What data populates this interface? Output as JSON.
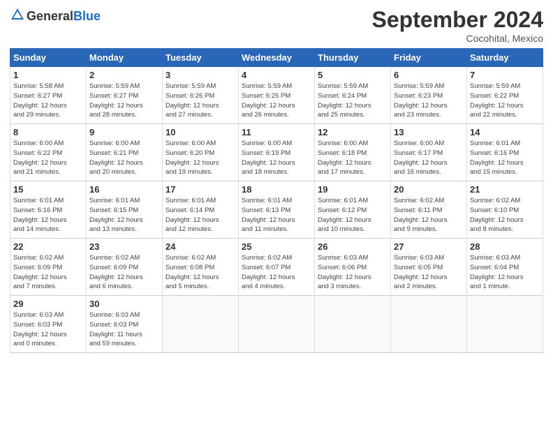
{
  "header": {
    "logo_general": "General",
    "logo_blue": "Blue",
    "title": "September 2024",
    "location": "Cocohital, Mexico"
  },
  "days_of_week": [
    "Sunday",
    "Monday",
    "Tuesday",
    "Wednesday",
    "Thursday",
    "Friday",
    "Saturday"
  ],
  "weeks": [
    [
      {
        "day": "1",
        "info": "Sunrise: 5:58 AM\nSunset: 6:27 PM\nDaylight: 12 hours\nand 29 minutes."
      },
      {
        "day": "2",
        "info": "Sunrise: 5:59 AM\nSunset: 6:27 PM\nDaylight: 12 hours\nand 28 minutes."
      },
      {
        "day": "3",
        "info": "Sunrise: 5:59 AM\nSunset: 6:26 PM\nDaylight: 12 hours\nand 27 minutes."
      },
      {
        "day": "4",
        "info": "Sunrise: 5:59 AM\nSunset: 6:25 PM\nDaylight: 12 hours\nand 26 minutes."
      },
      {
        "day": "5",
        "info": "Sunrise: 5:59 AM\nSunset: 6:24 PM\nDaylight: 12 hours\nand 25 minutes."
      },
      {
        "day": "6",
        "info": "Sunrise: 5:59 AM\nSunset: 6:23 PM\nDaylight: 12 hours\nand 23 minutes."
      },
      {
        "day": "7",
        "info": "Sunrise: 5:59 AM\nSunset: 6:22 PM\nDaylight: 12 hours\nand 22 minutes."
      }
    ],
    [
      {
        "day": "8",
        "info": "Sunrise: 6:00 AM\nSunset: 6:22 PM\nDaylight: 12 hours\nand 21 minutes."
      },
      {
        "day": "9",
        "info": "Sunrise: 6:00 AM\nSunset: 6:21 PM\nDaylight: 12 hours\nand 20 minutes."
      },
      {
        "day": "10",
        "info": "Sunrise: 6:00 AM\nSunset: 6:20 PM\nDaylight: 12 hours\nand 19 minutes."
      },
      {
        "day": "11",
        "info": "Sunrise: 6:00 AM\nSunset: 6:19 PM\nDaylight: 12 hours\nand 18 minutes."
      },
      {
        "day": "12",
        "info": "Sunrise: 6:00 AM\nSunset: 6:18 PM\nDaylight: 12 hours\nand 17 minutes."
      },
      {
        "day": "13",
        "info": "Sunrise: 6:00 AM\nSunset: 6:17 PM\nDaylight: 12 hours\nand 16 minutes."
      },
      {
        "day": "14",
        "info": "Sunrise: 6:01 AM\nSunset: 6:16 PM\nDaylight: 12 hours\nand 15 minutes."
      }
    ],
    [
      {
        "day": "15",
        "info": "Sunrise: 6:01 AM\nSunset: 6:16 PM\nDaylight: 12 hours\nand 14 minutes."
      },
      {
        "day": "16",
        "info": "Sunrise: 6:01 AM\nSunset: 6:15 PM\nDaylight: 12 hours\nand 13 minutes."
      },
      {
        "day": "17",
        "info": "Sunrise: 6:01 AM\nSunset: 6:14 PM\nDaylight: 12 hours\nand 12 minutes."
      },
      {
        "day": "18",
        "info": "Sunrise: 6:01 AM\nSunset: 6:13 PM\nDaylight: 12 hours\nand 11 minutes."
      },
      {
        "day": "19",
        "info": "Sunrise: 6:01 AM\nSunset: 6:12 PM\nDaylight: 12 hours\nand 10 minutes."
      },
      {
        "day": "20",
        "info": "Sunrise: 6:02 AM\nSunset: 6:11 PM\nDaylight: 12 hours\nand 9 minutes."
      },
      {
        "day": "21",
        "info": "Sunrise: 6:02 AM\nSunset: 6:10 PM\nDaylight: 12 hours\nand 8 minutes."
      }
    ],
    [
      {
        "day": "22",
        "info": "Sunrise: 6:02 AM\nSunset: 6:09 PM\nDaylight: 12 hours\nand 7 minutes."
      },
      {
        "day": "23",
        "info": "Sunrise: 6:02 AM\nSunset: 6:09 PM\nDaylight: 12 hours\nand 6 minutes."
      },
      {
        "day": "24",
        "info": "Sunrise: 6:02 AM\nSunset: 6:08 PM\nDaylight: 12 hours\nand 5 minutes."
      },
      {
        "day": "25",
        "info": "Sunrise: 6:02 AM\nSunset: 6:07 PM\nDaylight: 12 hours\nand 4 minutes."
      },
      {
        "day": "26",
        "info": "Sunrise: 6:03 AM\nSunset: 6:06 PM\nDaylight: 12 hours\nand 3 minutes."
      },
      {
        "day": "27",
        "info": "Sunrise: 6:03 AM\nSunset: 6:05 PM\nDaylight: 12 hours\nand 2 minutes."
      },
      {
        "day": "28",
        "info": "Sunrise: 6:03 AM\nSunset: 6:04 PM\nDaylight: 12 hours\nand 1 minute."
      }
    ],
    [
      {
        "day": "29",
        "info": "Sunrise: 6:03 AM\nSunset: 6:03 PM\nDaylight: 12 hours\nand 0 minutes."
      },
      {
        "day": "30",
        "info": "Sunrise: 6:03 AM\nSunset: 6:03 PM\nDaylight: 11 hours\nand 59 minutes."
      },
      null,
      null,
      null,
      null,
      null
    ]
  ]
}
